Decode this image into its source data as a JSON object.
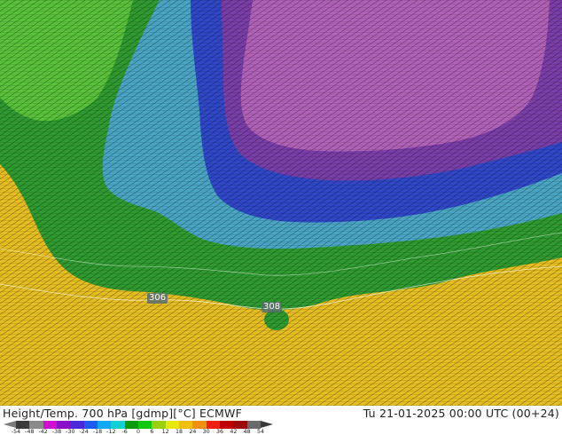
{
  "footer": {
    "title": "Height/Temp. 700 hPa [gdmp][°C] ECMWF",
    "datetime": "Tu 21-01-2025 00:00 UTC (00+24)"
  },
  "colorbar": {
    "ticks": [
      "-54",
      "-48",
      "-42",
      "-38",
      "-30",
      "-24",
      "-18",
      "-12",
      "-6",
      "0",
      "6",
      "12",
      "18",
      "24",
      "30",
      "36",
      "42",
      "48",
      "54"
    ],
    "colors": [
      "#3a3a3a",
      "#8a8a8a",
      "#d010d0",
      "#8c10c8",
      "#4a2ad8",
      "#1e5cf0",
      "#10a8f0",
      "#10d0d0",
      "#0a9a0a",
      "#10c810",
      "#9ad010",
      "#e8e810",
      "#f0c010",
      "#f09010",
      "#f02010",
      "#c00000",
      "#9a0a0a",
      "#6a6a6a"
    ]
  },
  "map": {
    "contour_labels": [
      "306",
      "308"
    ],
    "fill_colors": {
      "magenta": "#b060b8",
      "purple": "#7a3ea8",
      "blue": "#3050d0",
      "cyan": "#48a8c8",
      "green": "#30a030",
      "light_green": "#60c840",
      "yellow": "#e8c020"
    }
  }
}
